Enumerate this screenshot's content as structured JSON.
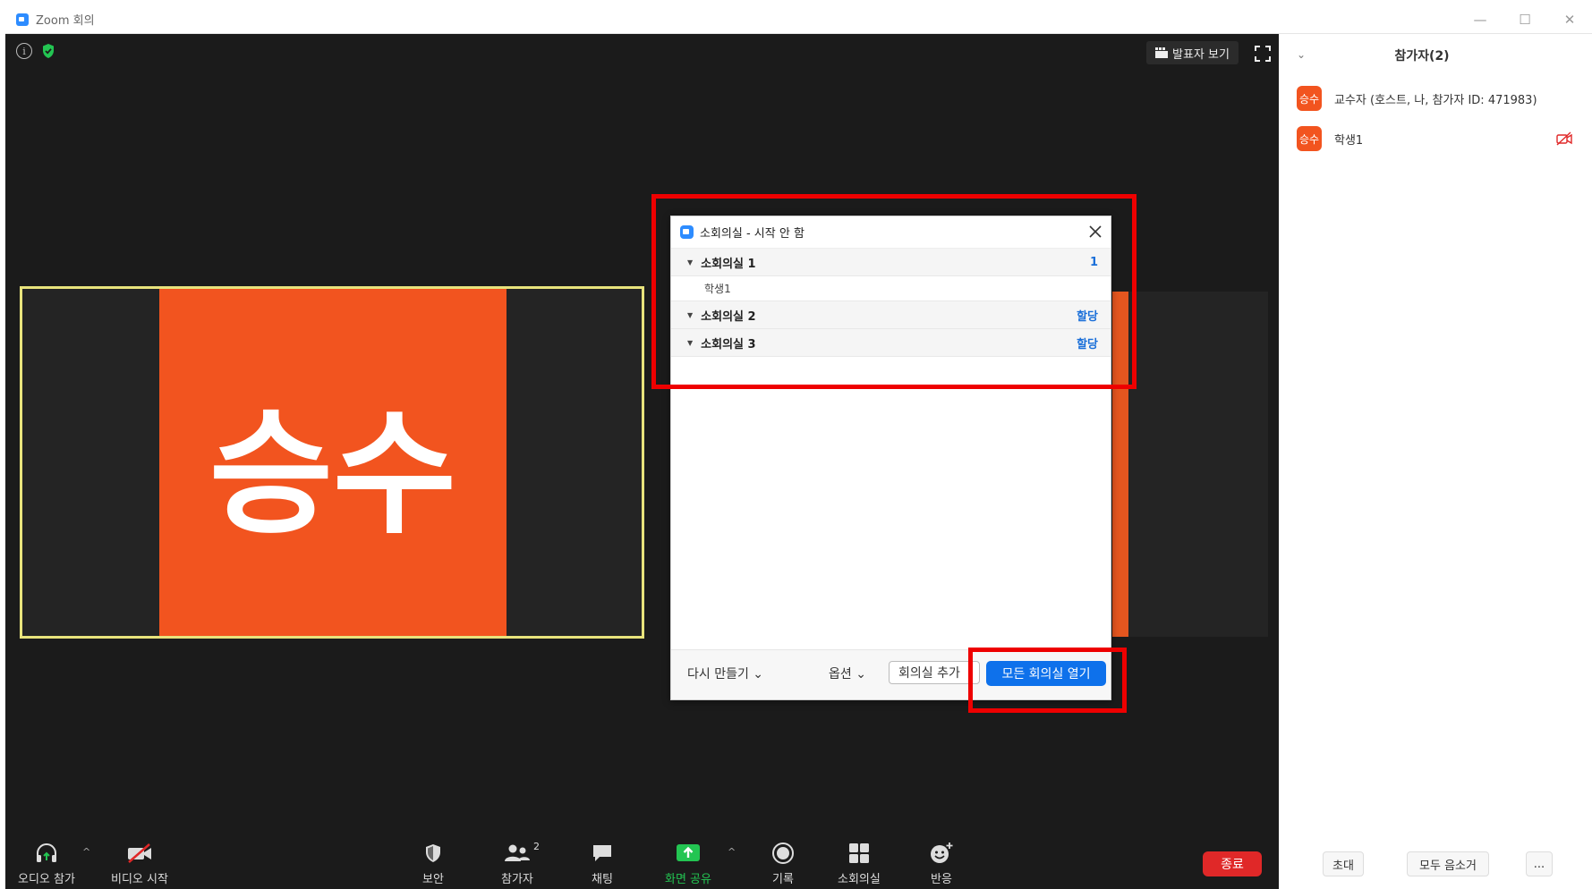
{
  "window": {
    "title": "Zoom 회의",
    "controls": [
      "—",
      "☐",
      "✕"
    ]
  },
  "meeting": {
    "speaker_view_label": "발표자 보기",
    "main_tile_name": "승수"
  },
  "toolbar": {
    "audio": "오디오 참가",
    "video": "비디오 시작",
    "security": "보안",
    "participants": "참가자",
    "participants_count": "2",
    "chat": "채팅",
    "share": "화면 공유",
    "record": "기록",
    "breakout": "소회의실",
    "reactions": "반응",
    "end": "종료"
  },
  "panel": {
    "title": "참가자(2)",
    "participants": [
      {
        "avatar": "승수",
        "name": "교수자 (호스트, 나, 참가자 ID: 471983)"
      },
      {
        "avatar": "승수",
        "name": "학생1"
      }
    ],
    "invite": "초대",
    "mute_all": "모두 음소거",
    "more": "..."
  },
  "dialog": {
    "title": "소회의실 - 시작 안 함",
    "rooms": [
      {
        "name": "소회의실 1",
        "value": "1"
      },
      {
        "name": "소회의실 2",
        "value": "할당"
      },
      {
        "name": "소회의실 3",
        "value": "할당"
      }
    ],
    "room1_member": "학생1",
    "recreate": "다시 만들기",
    "options": "옵션",
    "add_room": "회의실 추가",
    "open_all": "모든 회의실 열기"
  },
  "colors": {
    "accent_blue": "#0e71eb",
    "avatar_orange": "#f2541f",
    "highlight_red": "#ee0000",
    "active_green": "#23c552"
  }
}
